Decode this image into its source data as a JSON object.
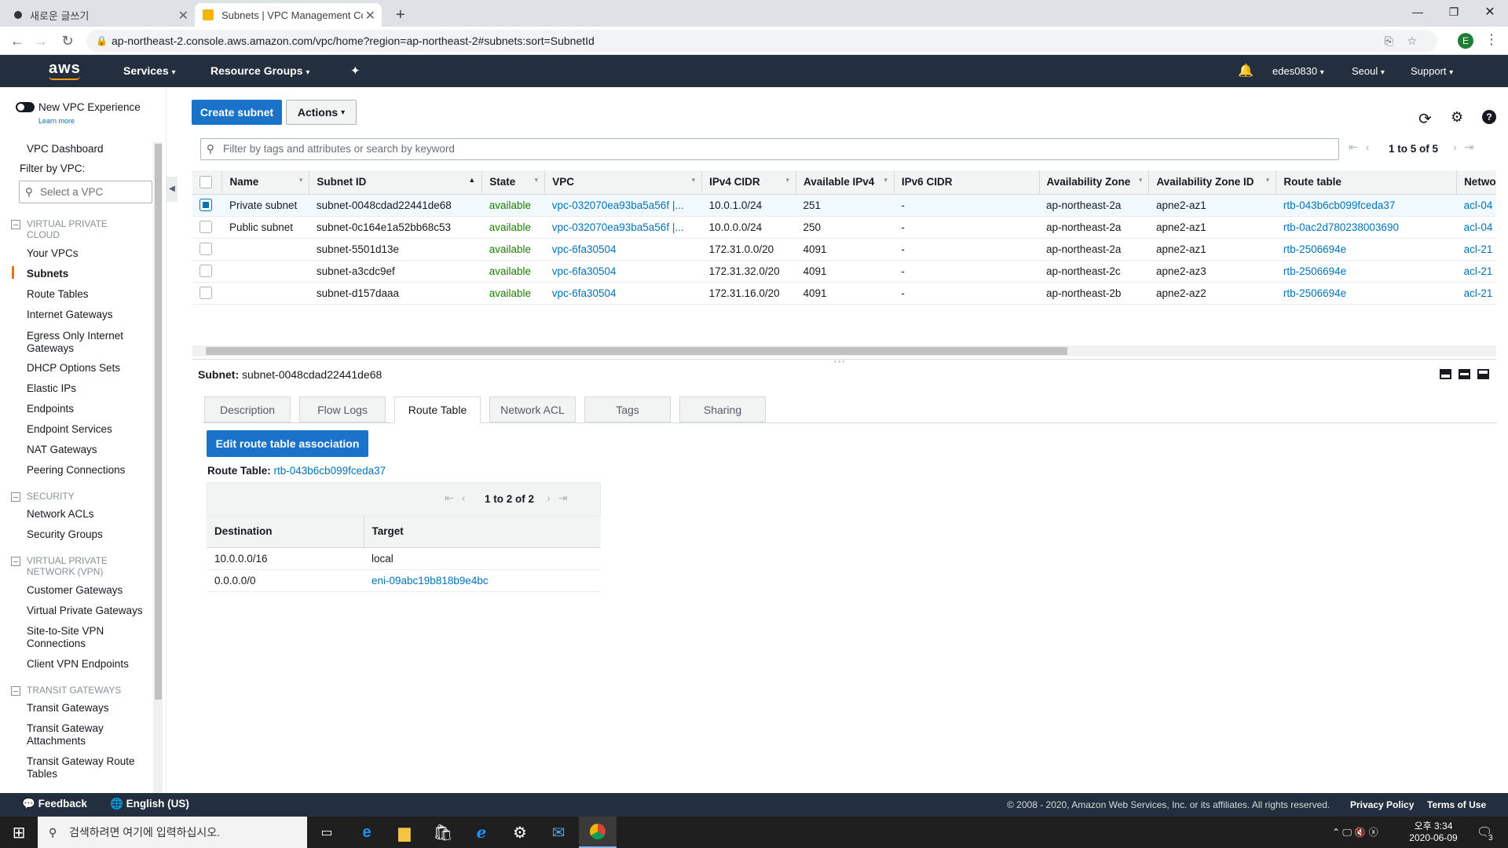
{
  "browser": {
    "tabs": [
      {
        "title": "새로운 글쓰기",
        "active": false
      },
      {
        "title": "Subnets | VPC Management Co",
        "active": true
      }
    ],
    "new_tab": "+",
    "url": "ap-northeast-2.console.aws.amazon.com/vpc/home?region=ap-northeast-2#subnets:sort=SubnetId",
    "profile_initial": "E"
  },
  "aws_header": {
    "logo": "aws",
    "services": "Services",
    "resource_groups": "Resource Groups",
    "user": "edes0830",
    "region": "Seoul",
    "support": "Support"
  },
  "sidebar": {
    "new_vpc_experience": "New VPC Experience",
    "learn_more": "Learn more",
    "dashboard": "VPC Dashboard",
    "filter_label": "Filter by VPC:",
    "filter_placeholder": "Select a VPC",
    "sections": [
      {
        "header": "VIRTUAL PRIVATE CLOUD",
        "items": [
          "Your VPCs",
          "Subnets",
          "Route Tables",
          "Internet Gateways",
          "Egress Only Internet Gateways",
          "DHCP Options Sets",
          "Elastic IPs",
          "Endpoints",
          "Endpoint Services",
          "NAT Gateways",
          "Peering Connections"
        ]
      },
      {
        "header": "SECURITY",
        "items": [
          "Network ACLs",
          "Security Groups"
        ]
      },
      {
        "header": "VIRTUAL PRIVATE NETWORK (VPN)",
        "items": [
          "Customer Gateways",
          "Virtual Private Gateways",
          "Site-to-Site VPN Connections",
          "Client VPN Endpoints"
        ]
      },
      {
        "header": "TRANSIT GATEWAYS",
        "items": [
          "Transit Gateways",
          "Transit Gateway Attachments",
          "Transit Gateway Route Tables"
        ]
      }
    ],
    "active_item": "Subnets"
  },
  "toolbar": {
    "create_subnet": "Create subnet",
    "actions": "Actions"
  },
  "search": {
    "placeholder": "Filter by tags and attributes or search by keyword"
  },
  "pagination": "1 to 5 of 5",
  "subnets_table": {
    "columns": [
      "Name",
      "Subnet ID",
      "State",
      "VPC",
      "IPv4 CIDR",
      "Available IPv4",
      "IPv6 CIDR",
      "Availability Zone",
      "Availability Zone ID",
      "Route table",
      "Netwo"
    ],
    "rows": [
      {
        "selected": true,
        "name": "Private subnet",
        "subnet_id": "subnet-0048cdad22441de68",
        "state": "available",
        "vpc": "vpc-032070ea93ba5a56f |...",
        "ipv4": "10.0.1.0/24",
        "avail_ipv4": "251",
        "ipv6": "-",
        "az": "ap-northeast-2a",
        "az_id": "apne2-az1",
        "route_table": "rtb-043b6cb099fceda37",
        "nacl": "acl-04"
      },
      {
        "selected": false,
        "name": "Public subnet",
        "subnet_id": "subnet-0c164e1a52bb68c53",
        "state": "available",
        "vpc": "vpc-032070ea93ba5a56f |...",
        "ipv4": "10.0.0.0/24",
        "avail_ipv4": "250",
        "ipv6": "-",
        "az": "ap-northeast-2a",
        "az_id": "apne2-az1",
        "route_table": "rtb-0ac2d780238003690",
        "nacl": "acl-04"
      },
      {
        "selected": false,
        "name": "",
        "subnet_id": "subnet-5501d13e",
        "state": "available",
        "vpc": "vpc-6fa30504",
        "ipv4": "172.31.0.0/20",
        "avail_ipv4": "4091",
        "ipv6": "-",
        "az": "ap-northeast-2a",
        "az_id": "apne2-az1",
        "route_table": "rtb-2506694e",
        "nacl": "acl-21"
      },
      {
        "selected": false,
        "name": "",
        "subnet_id": "subnet-a3cdc9ef",
        "state": "available",
        "vpc": "vpc-6fa30504",
        "ipv4": "172.31.32.0/20",
        "avail_ipv4": "4091",
        "ipv6": "-",
        "az": "ap-northeast-2c",
        "az_id": "apne2-az3",
        "route_table": "rtb-2506694e",
        "nacl": "acl-21"
      },
      {
        "selected": false,
        "name": "",
        "subnet_id": "subnet-d157daaa",
        "state": "available",
        "vpc": "vpc-6fa30504",
        "ipv4": "172.31.16.0/20",
        "avail_ipv4": "4091",
        "ipv6": "-",
        "az": "ap-northeast-2b",
        "az_id": "apne2-az2",
        "route_table": "rtb-2506694e",
        "nacl": "acl-21"
      }
    ]
  },
  "detail": {
    "label": "Subnet:",
    "subnet_id": "subnet-0048cdad22441de68",
    "tabs": [
      "Description",
      "Flow Logs",
      "Route Table",
      "Network ACL",
      "Tags",
      "Sharing"
    ],
    "active_tab": "Route Table",
    "edit_button": "Edit route table association",
    "route_table_label": "Route Table:",
    "route_table_id": "rtb-043b6cb099fceda37",
    "pagination": "1 to 2 of 2",
    "columns": [
      "Destination",
      "Target"
    ],
    "routes": [
      {
        "destination": "10.0.0.0/16",
        "target": "local",
        "target_link": false
      },
      {
        "destination": "0.0.0.0/0",
        "target": "eni-09abc19b818b9e4bc",
        "target_link": true
      }
    ]
  },
  "footer": {
    "feedback": "Feedback",
    "language": "English (US)",
    "copyright": "© 2008 - 2020, Amazon Web Services, Inc. or its affiliates. All rights reserved.",
    "privacy": "Privacy Policy",
    "terms": "Terms of Use"
  },
  "taskbar": {
    "search_placeholder": "검색하려면 여기에 입력하십시오.",
    "time": "오후 3:34",
    "date": "2020-06-09",
    "notification_count": "3"
  },
  "colors": {
    "aws_nav": "#232f3e",
    "primary": "#1a73c9",
    "link": "#0073bb",
    "available": "#1d8102",
    "active_nav": "#ec7211"
  }
}
